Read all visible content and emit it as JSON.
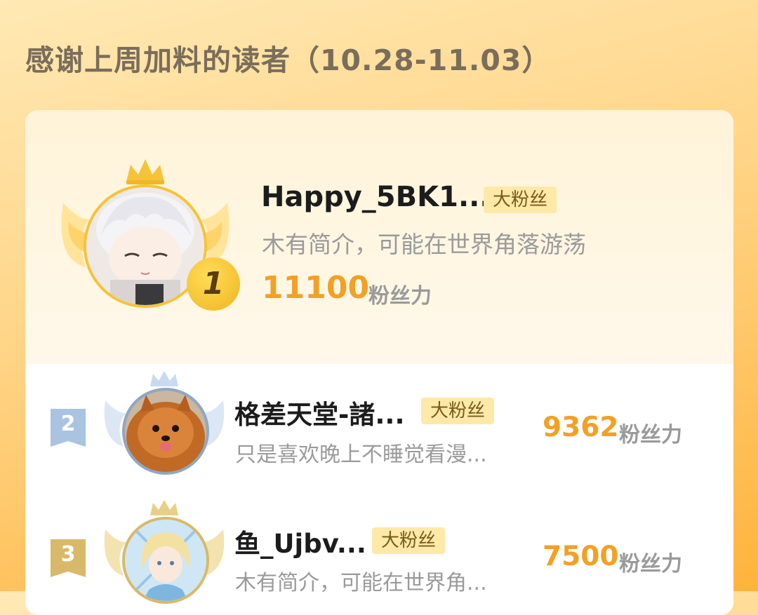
{
  "header": {
    "title": "感谢上周加料的读者（10.28-11.03）"
  },
  "ranking": [
    {
      "rank": "1",
      "name": "Happy_5BK1...",
      "badge": "大粉丝",
      "bio": "木有简介，可能在世界角落游荡",
      "score": "11100",
      "score_unit": "粉丝力",
      "avatar_icon": "anime-boy-avatar-icon",
      "rank_color": "#f0b726"
    },
    {
      "rank": "2",
      "name": "格差天堂-諸...",
      "badge": "大粉丝",
      "bio": "只是喜欢晚上不睡觉看漫...",
      "score": "9362",
      "score_unit": "粉丝力",
      "avatar_icon": "pomeranian-dog-avatar-icon",
      "rank_color": "#a9c3e0"
    },
    {
      "rank": "3",
      "name": "鱼_Ujbv...",
      "badge": "大粉丝",
      "bio": "木有简介，可能在世界角...",
      "score": "7500",
      "score_unit": "粉丝力",
      "avatar_icon": "anime-girl-avatar-icon",
      "rank_color": "#d8b96a"
    }
  ],
  "colors": {
    "accent_score": "#f3a024",
    "badge_bg": "#ffe9a8",
    "gold": "#f6c338",
    "silver": "#c9daf0",
    "bronze": "#e8cf88"
  }
}
